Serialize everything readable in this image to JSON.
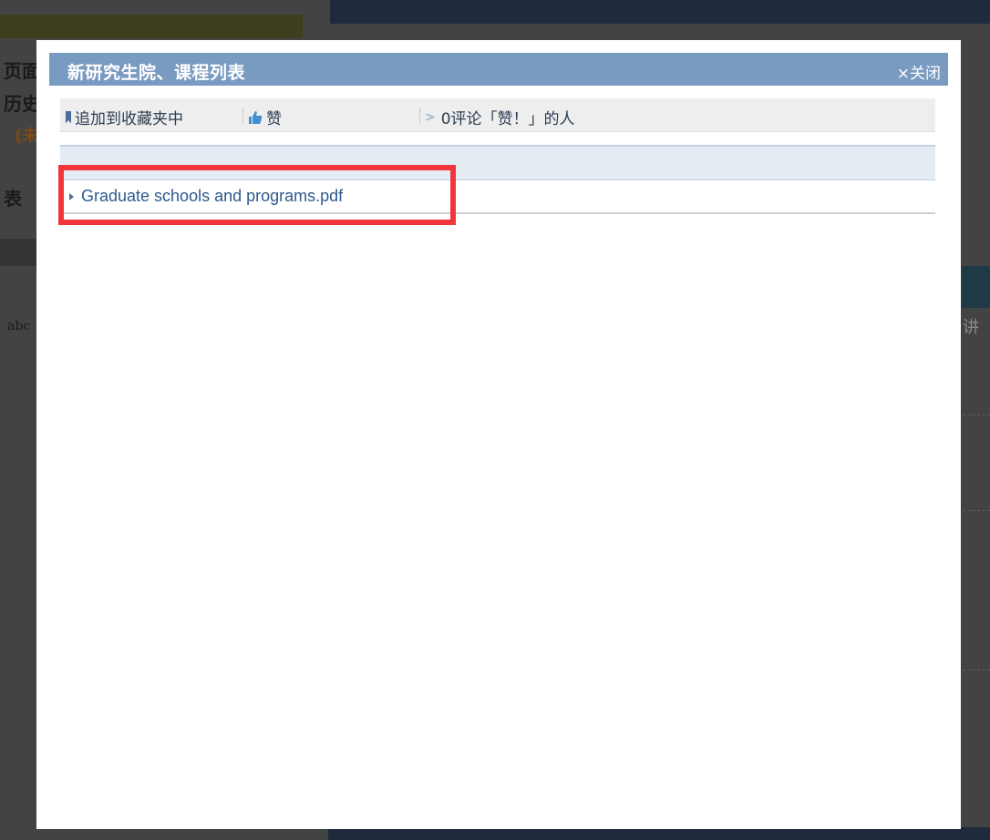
{
  "background": {
    "left_lines": [
      "页面",
      "历史",
      "(未",
      "表"
    ],
    "left_small": "abc",
    "right_text": "讲"
  },
  "modal": {
    "title": "新研究生院、课程列表",
    "close_label": "×关闭",
    "toolbar": {
      "bookmark_label": "追加到收藏夹中",
      "like_label": "赞",
      "comment_label": "0评论「赞！」的人"
    },
    "files": [
      {
        "name": "Graduate schools and programs.pdf"
      }
    ]
  },
  "colors": {
    "header_bg": "#7a9bc1",
    "link": "#2d5a8e",
    "highlight": "#f0363b",
    "overlay": "#434343"
  },
  "icons": [
    "bookmark-icon",
    "thumbs-up-icon",
    "arrow-icon",
    "triangle-bullet-icon"
  ]
}
